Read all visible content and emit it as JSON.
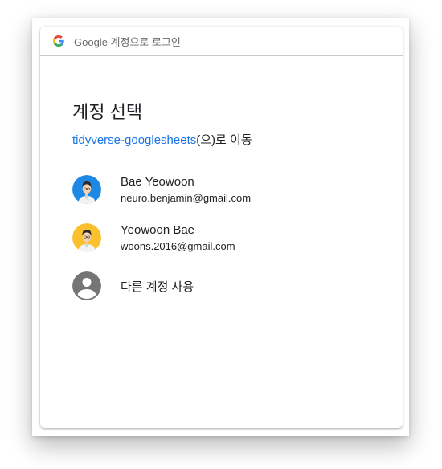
{
  "header": {
    "brand": "Google",
    "title": "계정으로 로그인"
  },
  "main": {
    "title": "계정 선택",
    "app_name": "tidyverse-googlesheets",
    "subtitle_suffix": "(으)로 이동"
  },
  "accounts": [
    {
      "name": "Bae Yeowoon",
      "email": "neuro.benjamin@gmail.com",
      "avatar_bg": "#1e88e5"
    },
    {
      "name": "Yeowoon Bae",
      "email": "woons.2016@gmail.com",
      "avatar_bg": "#fbc02d"
    }
  ],
  "other_account": {
    "label": "다른 계정 사용",
    "icon": "account-circle-icon"
  },
  "colors": {
    "link": "#1a73e8",
    "text": "#202124",
    "icon_gray": "#757575"
  }
}
